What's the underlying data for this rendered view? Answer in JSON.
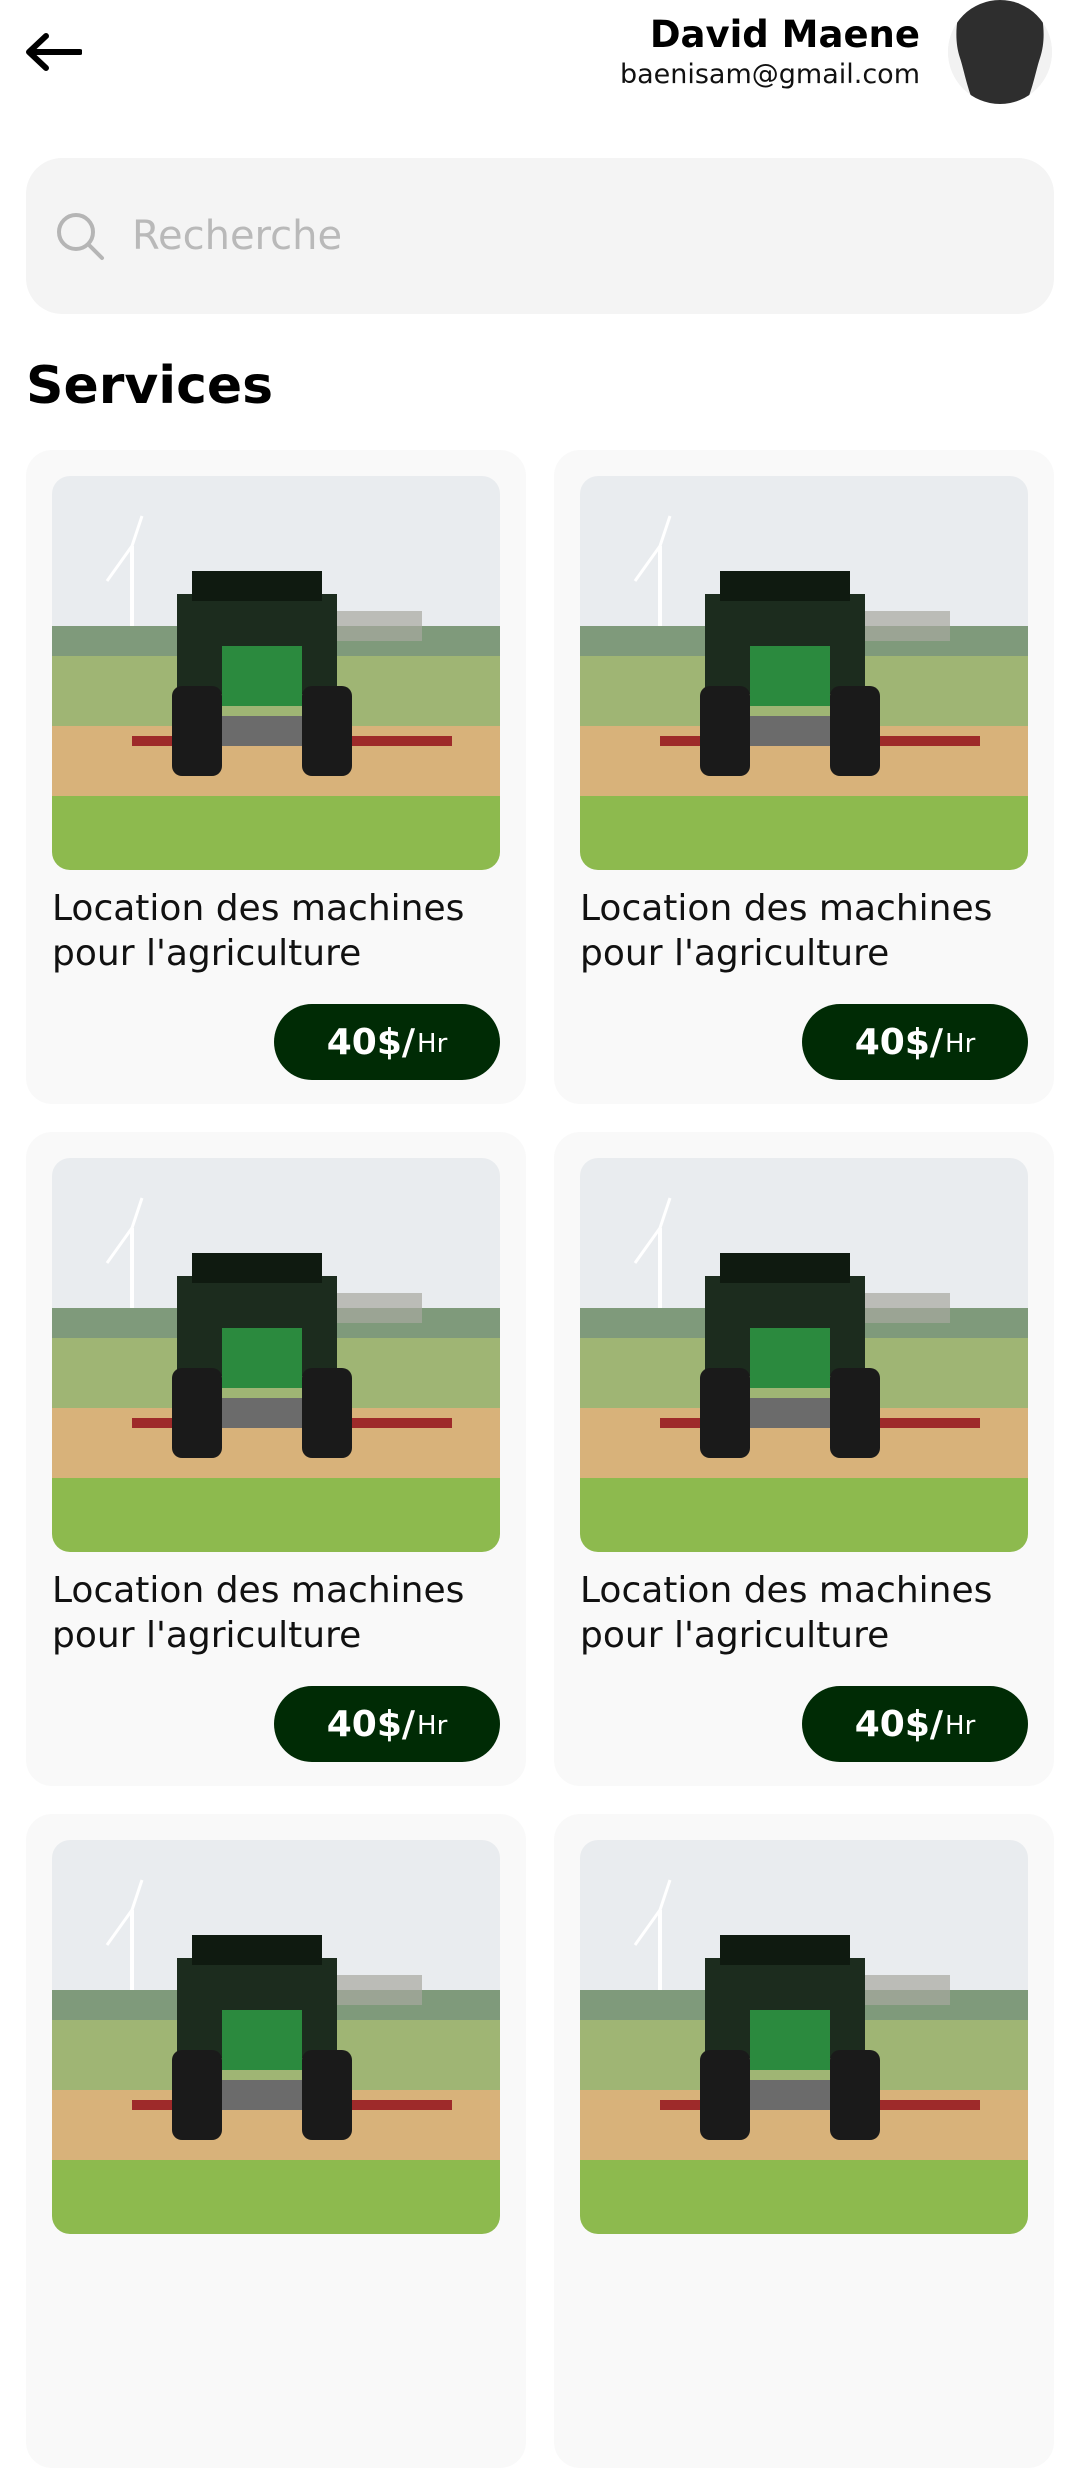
{
  "header": {
    "user_name": "David Maene",
    "user_email": "baenisam@gmail.com"
  },
  "search": {
    "placeholder": "Recherche"
  },
  "section_title": "Services",
  "services": [
    {
      "title": "Location des machines pour l'agriculture",
      "price": "40$/",
      "unit": "Hr",
      "image": "tractor-photo"
    },
    {
      "title": "Location des machines pour l'agriculture",
      "price": "40$/",
      "unit": "Hr",
      "image": "tractor-photo"
    },
    {
      "title": "Location des machines pour l'agriculture",
      "price": "40$/",
      "unit": "Hr",
      "image": "tractor-photo"
    },
    {
      "title": "Location des machines pour l'agriculture",
      "price": "40$/",
      "unit": "Hr",
      "image": "tractor-photo"
    },
    {
      "title": "",
      "price": "",
      "unit": "",
      "image": "tractor-photo"
    },
    {
      "title": "",
      "price": "",
      "unit": "",
      "image": "tractor-photo"
    }
  ],
  "colors": {
    "price_bg": "#002b05",
    "card_bg": "#f9f9f9",
    "search_bg": "#f4f4f4"
  },
  "icons": [
    "back-arrow-icon",
    "search-icon",
    "avatar"
  ]
}
